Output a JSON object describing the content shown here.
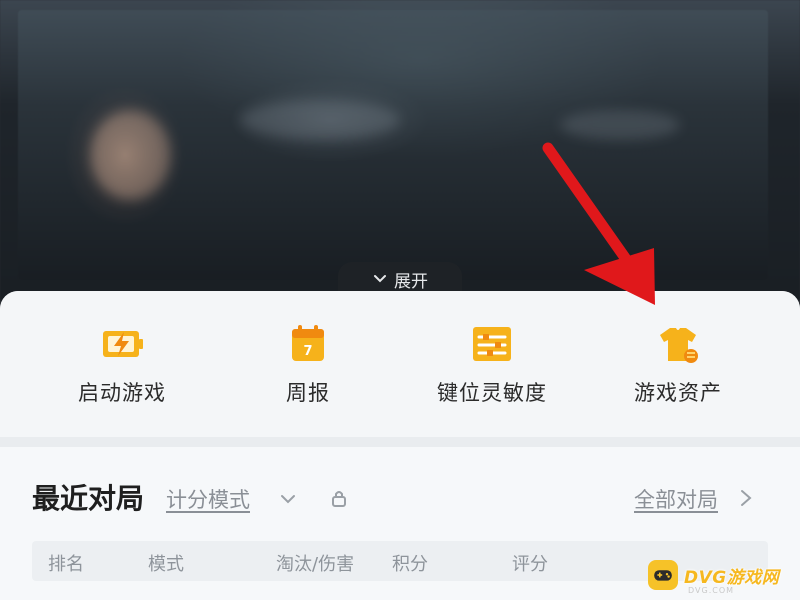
{
  "expand": {
    "label": "展开"
  },
  "quick_actions": [
    {
      "label": "启动游戏",
      "icon": "lightning-battery-icon"
    },
    {
      "label": "周报",
      "icon": "calendar-icon"
    },
    {
      "label": "键位灵敏度",
      "icon": "sliders-icon"
    },
    {
      "label": "游戏资产",
      "icon": "tshirt-coin-icon"
    }
  ],
  "recent": {
    "title": "最近对局",
    "score_mode": "计分模式",
    "all_games": "全部对局",
    "columns": [
      "排名",
      "模式",
      "淘汰/伤害",
      "积分",
      "评分"
    ]
  },
  "watermark": {
    "text": "DVG游戏网",
    "sub": "DVG.COM"
  },
  "colors": {
    "accent": "#f6b21b",
    "arrow": "#e0181b",
    "panel": "#f4f6f8"
  }
}
